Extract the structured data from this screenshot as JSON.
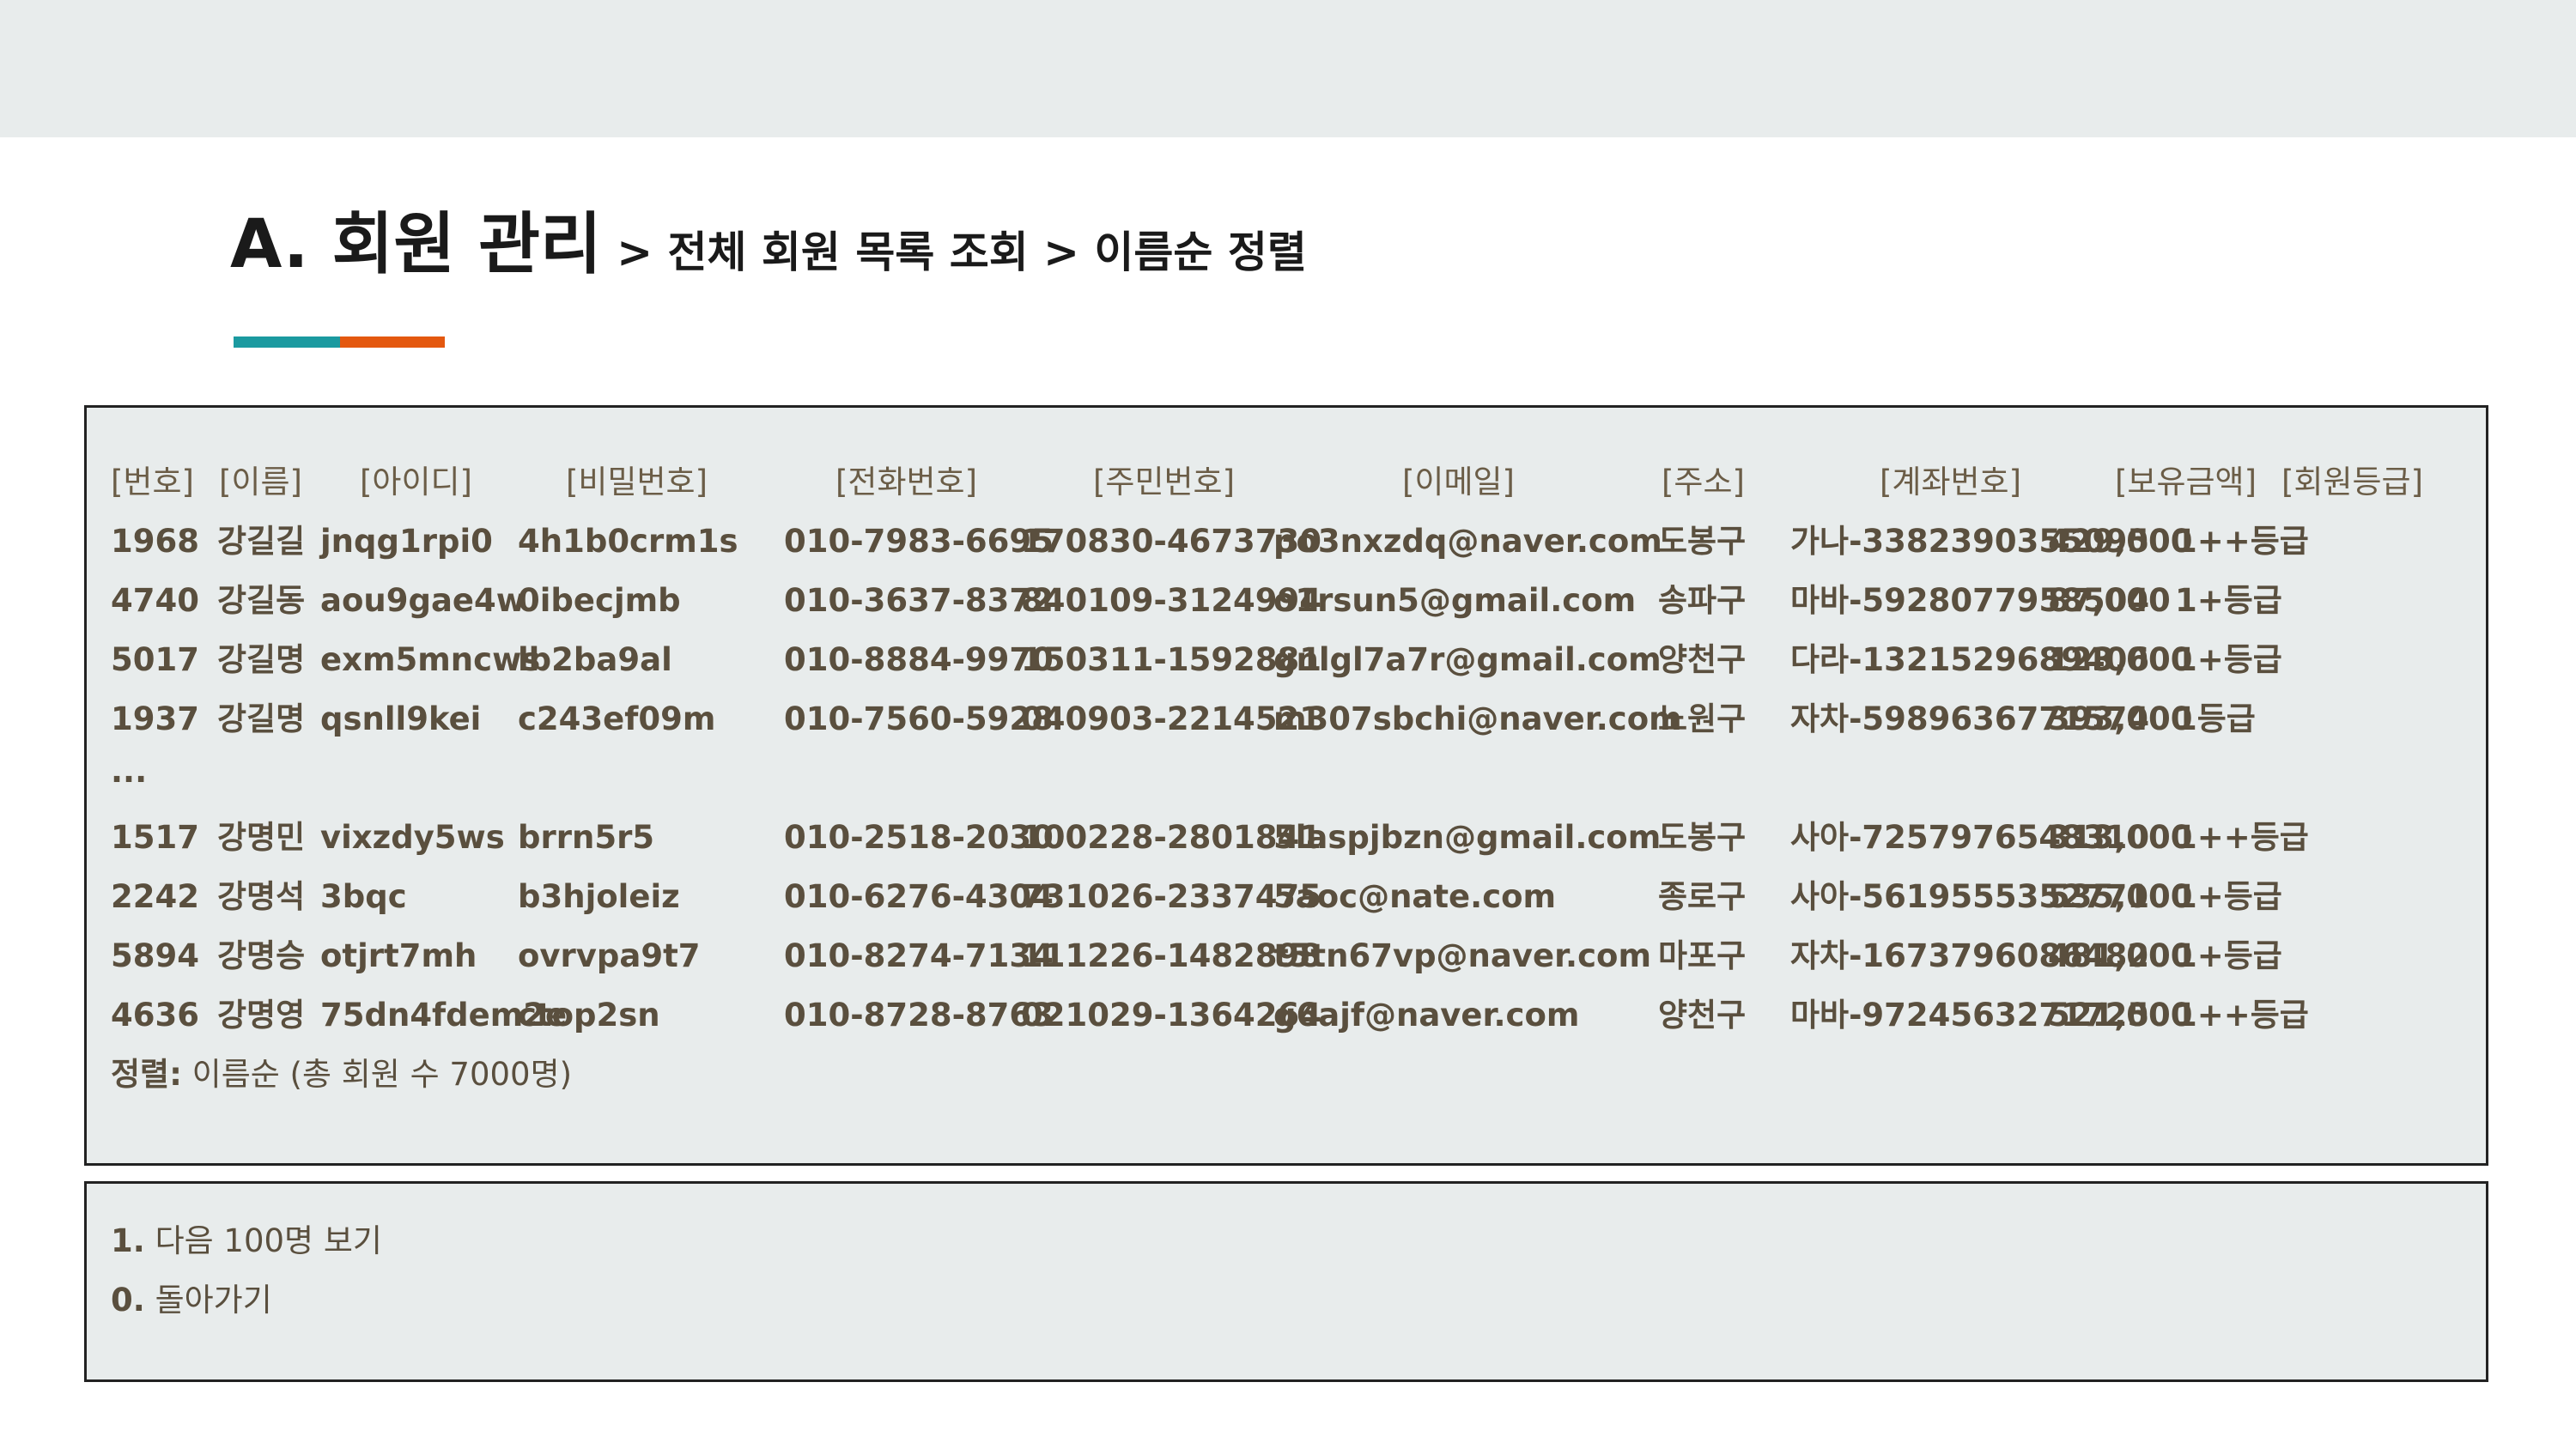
{
  "title": {
    "main": "A. 회원 관리",
    "crumb": " > 전체 회원 목록 조회 > 이름순 정렬"
  },
  "colors": {
    "accent_teal": "#1b9aa0",
    "accent_orange": "#e4580f",
    "panel_bg": "#e8ecec",
    "text": "#5a4f3e"
  },
  "table": {
    "headers": [
      "[번호]",
      "[이름]",
      "[아이디]",
      "[비밀번호]",
      "[전화번호]",
      "[주민번호]",
      "[이메일]",
      "[주소]",
      "[계좌번호]",
      "[보유금액]",
      "[회원등급]"
    ],
    "rows_top": [
      [
        "1968",
        "강길길",
        "jnqg1rpi0",
        "4h1b0crm1s",
        "010-7983-6695",
        "170830-4673730",
        "po3nxzdq@naver.com",
        "도봉구",
        "가나-3382390355095",
        "429,000",
        "1++등급"
      ],
      [
        "4740",
        "강길동",
        "aou9gae4w",
        "0ibecjmb",
        "010-3637-8372",
        "840109-3124994",
        "o1rsun5@gmail.com",
        "송파구",
        "마바-5928077958504",
        "87,000",
        "1+등급"
      ],
      [
        "5017",
        "강길명",
        "exm5mncws",
        "lb2ba9al",
        "010-8884-9970",
        "150311-1592881",
        "gnlgl7a7r@gmail.com",
        "양천구",
        "다라-1321529689406",
        "123,000",
        "1+등급"
      ],
      [
        "1937",
        "강길명",
        "qsnll9kei",
        "c243ef09m",
        "010-7560-5928",
        "040903-2214521",
        "m307sbchi@naver.com",
        "노원구",
        "자차-5989636771574",
        "393,000",
        "1등급"
      ]
    ],
    "ellipsis": "...",
    "rows_bottom": [
      [
        "1517",
        "강명민",
        "vixzdy5ws",
        "brrn5r5",
        "010-2518-2030",
        "100228-2801841",
        "5laspjbzn@gmail.com",
        "도봉구",
        "사아-7257976548310",
        "313,000",
        "1++등급"
      ],
      [
        "2242",
        "강명석",
        "3bqc",
        "b3hjoleiz",
        "010-6276-4304",
        "731026-2337475",
        "5aoc@nate.com",
        "종로구",
        "사아-5619555352771",
        "535,000",
        "1+등급"
      ],
      [
        "5894",
        "강명승",
        "otjrt7mh",
        "ovrvpa9t7",
        "010-8274-7134",
        "111226-1482898",
        "t5tn67vp@naver.com",
        "마포구",
        "자차-1673796086482",
        "481,000",
        "1+등급"
      ],
      [
        "4636",
        "강명영",
        "75dn4fdem2e",
        "ctop2sn",
        "010-8728-8763",
        "021029-1364264",
        "g6ajf@naver.com",
        "양천구",
        "마바-9724563271725",
        "521,000",
        "1++등급"
      ]
    ],
    "footer_label": "정렬:",
    "footer_text": " 이름순 (총 회원 수 7000명)"
  },
  "menu": {
    "items": [
      {
        "key": "1.",
        "label": " 다음 100명 보기"
      },
      {
        "key": "0.",
        "label": " 돌아가기"
      }
    ]
  }
}
